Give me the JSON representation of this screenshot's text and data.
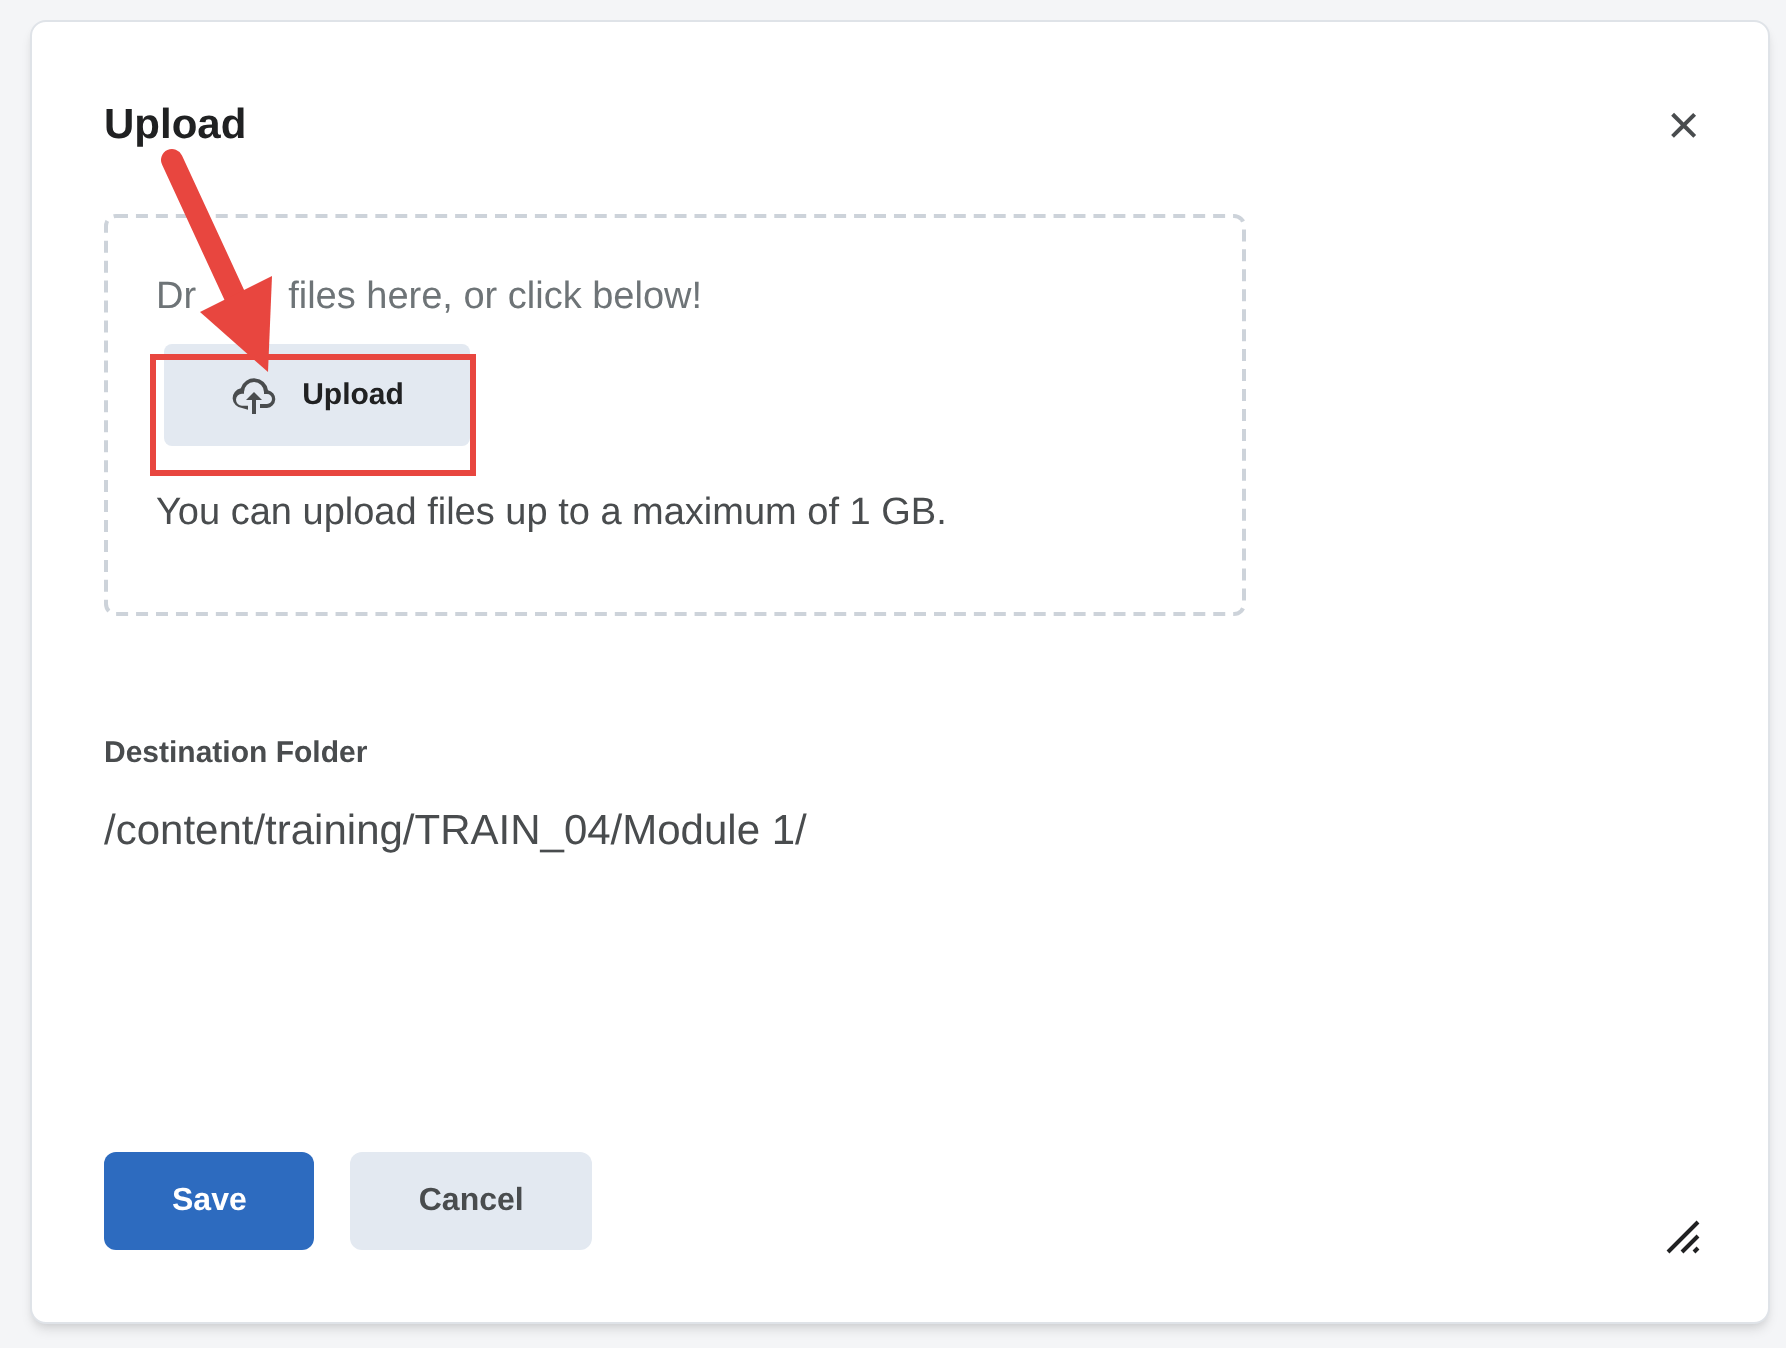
{
  "dialog": {
    "title": "Upload",
    "close": "×"
  },
  "dropzone": {
    "hint_parts": [
      "Dr",
      "files here, or click below!"
    ],
    "upload_button": "Upload",
    "limit": "You can upload files up to a maximum of 1 GB."
  },
  "destination": {
    "label": "Destination Folder",
    "path": "/content/training/TRAIN_04/Module 1/"
  },
  "buttons": [
    {
      "label": "Save",
      "kind": "primary"
    },
    {
      "label": "Cancel",
      "kind": "secondary"
    }
  ]
}
